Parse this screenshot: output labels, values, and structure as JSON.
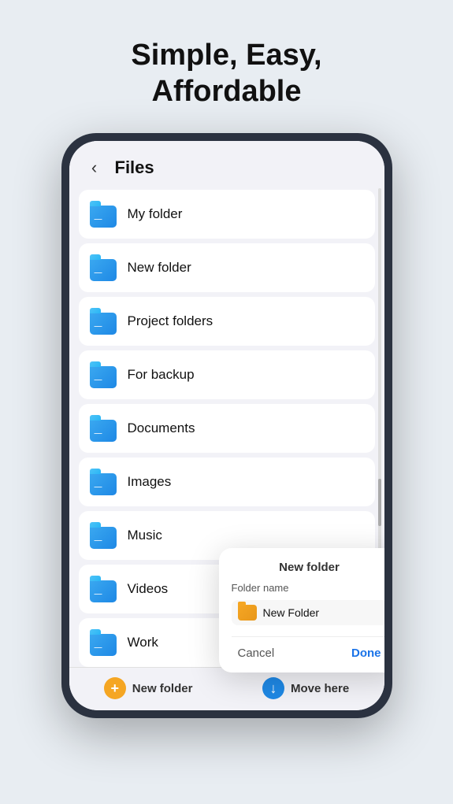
{
  "header": {
    "title_line1": "Simple, Easy,",
    "title_line2": "Affordable"
  },
  "phone": {
    "screen": {
      "files_header": {
        "back_label": "‹",
        "title": "Files"
      },
      "folders": [
        {
          "name": "My folder"
        },
        {
          "name": "New folder"
        },
        {
          "name": "Project folders"
        },
        {
          "name": "For backup"
        },
        {
          "name": "Documents"
        },
        {
          "name": "Images"
        },
        {
          "name": "Music"
        },
        {
          "name": "Videos"
        },
        {
          "name": "Work"
        }
      ],
      "bottom_bar": {
        "new_folder_label": "New folder",
        "move_here_label": "Move here"
      }
    }
  },
  "dialog": {
    "title": "New folder",
    "folder_name_label": "Folder name",
    "folder_name_value": "New Folder",
    "cancel_label": "Cancel",
    "done_label": "Done"
  }
}
